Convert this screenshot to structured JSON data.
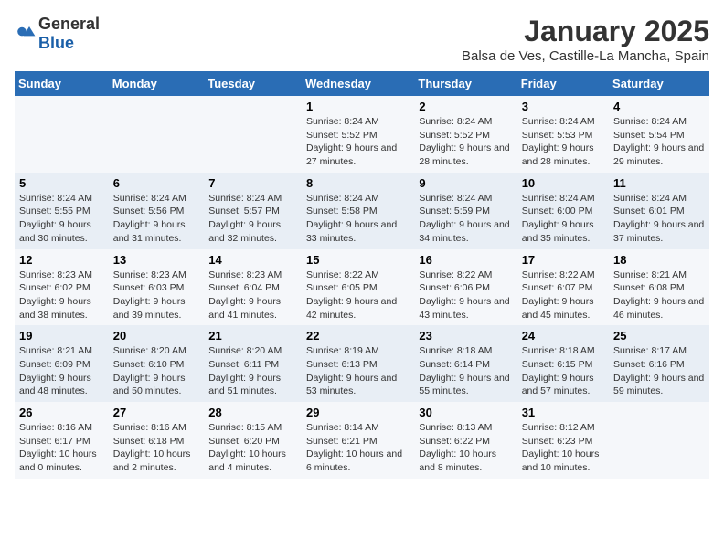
{
  "logo": {
    "general": "General",
    "blue": "Blue"
  },
  "title": "January 2025",
  "subtitle": "Balsa de Ves, Castille-La Mancha, Spain",
  "weekdays": [
    "Sunday",
    "Monday",
    "Tuesday",
    "Wednesday",
    "Thursday",
    "Friday",
    "Saturday"
  ],
  "weeks": [
    [
      {
        "day": "",
        "content": ""
      },
      {
        "day": "",
        "content": ""
      },
      {
        "day": "",
        "content": ""
      },
      {
        "day": "1",
        "content": "Sunrise: 8:24 AM\nSunset: 5:52 PM\nDaylight: 9 hours and 27 minutes."
      },
      {
        "day": "2",
        "content": "Sunrise: 8:24 AM\nSunset: 5:52 PM\nDaylight: 9 hours and 28 minutes."
      },
      {
        "day": "3",
        "content": "Sunrise: 8:24 AM\nSunset: 5:53 PM\nDaylight: 9 hours and 28 minutes."
      },
      {
        "day": "4",
        "content": "Sunrise: 8:24 AM\nSunset: 5:54 PM\nDaylight: 9 hours and 29 minutes."
      }
    ],
    [
      {
        "day": "5",
        "content": "Sunrise: 8:24 AM\nSunset: 5:55 PM\nDaylight: 9 hours and 30 minutes."
      },
      {
        "day": "6",
        "content": "Sunrise: 8:24 AM\nSunset: 5:56 PM\nDaylight: 9 hours and 31 minutes."
      },
      {
        "day": "7",
        "content": "Sunrise: 8:24 AM\nSunset: 5:57 PM\nDaylight: 9 hours and 32 minutes."
      },
      {
        "day": "8",
        "content": "Sunrise: 8:24 AM\nSunset: 5:58 PM\nDaylight: 9 hours and 33 minutes."
      },
      {
        "day": "9",
        "content": "Sunrise: 8:24 AM\nSunset: 5:59 PM\nDaylight: 9 hours and 34 minutes."
      },
      {
        "day": "10",
        "content": "Sunrise: 8:24 AM\nSunset: 6:00 PM\nDaylight: 9 hours and 35 minutes."
      },
      {
        "day": "11",
        "content": "Sunrise: 8:24 AM\nSunset: 6:01 PM\nDaylight: 9 hours and 37 minutes."
      }
    ],
    [
      {
        "day": "12",
        "content": "Sunrise: 8:23 AM\nSunset: 6:02 PM\nDaylight: 9 hours and 38 minutes."
      },
      {
        "day": "13",
        "content": "Sunrise: 8:23 AM\nSunset: 6:03 PM\nDaylight: 9 hours and 39 minutes."
      },
      {
        "day": "14",
        "content": "Sunrise: 8:23 AM\nSunset: 6:04 PM\nDaylight: 9 hours and 41 minutes."
      },
      {
        "day": "15",
        "content": "Sunrise: 8:22 AM\nSunset: 6:05 PM\nDaylight: 9 hours and 42 minutes."
      },
      {
        "day": "16",
        "content": "Sunrise: 8:22 AM\nSunset: 6:06 PM\nDaylight: 9 hours and 43 minutes."
      },
      {
        "day": "17",
        "content": "Sunrise: 8:22 AM\nSunset: 6:07 PM\nDaylight: 9 hours and 45 minutes."
      },
      {
        "day": "18",
        "content": "Sunrise: 8:21 AM\nSunset: 6:08 PM\nDaylight: 9 hours and 46 minutes."
      }
    ],
    [
      {
        "day": "19",
        "content": "Sunrise: 8:21 AM\nSunset: 6:09 PM\nDaylight: 9 hours and 48 minutes."
      },
      {
        "day": "20",
        "content": "Sunrise: 8:20 AM\nSunset: 6:10 PM\nDaylight: 9 hours and 50 minutes."
      },
      {
        "day": "21",
        "content": "Sunrise: 8:20 AM\nSunset: 6:11 PM\nDaylight: 9 hours and 51 minutes."
      },
      {
        "day": "22",
        "content": "Sunrise: 8:19 AM\nSunset: 6:13 PM\nDaylight: 9 hours and 53 minutes."
      },
      {
        "day": "23",
        "content": "Sunrise: 8:18 AM\nSunset: 6:14 PM\nDaylight: 9 hours and 55 minutes."
      },
      {
        "day": "24",
        "content": "Sunrise: 8:18 AM\nSunset: 6:15 PM\nDaylight: 9 hours and 57 minutes."
      },
      {
        "day": "25",
        "content": "Sunrise: 8:17 AM\nSunset: 6:16 PM\nDaylight: 9 hours and 59 minutes."
      }
    ],
    [
      {
        "day": "26",
        "content": "Sunrise: 8:16 AM\nSunset: 6:17 PM\nDaylight: 10 hours and 0 minutes."
      },
      {
        "day": "27",
        "content": "Sunrise: 8:16 AM\nSunset: 6:18 PM\nDaylight: 10 hours and 2 minutes."
      },
      {
        "day": "28",
        "content": "Sunrise: 8:15 AM\nSunset: 6:20 PM\nDaylight: 10 hours and 4 minutes."
      },
      {
        "day": "29",
        "content": "Sunrise: 8:14 AM\nSunset: 6:21 PM\nDaylight: 10 hours and 6 minutes."
      },
      {
        "day": "30",
        "content": "Sunrise: 8:13 AM\nSunset: 6:22 PM\nDaylight: 10 hours and 8 minutes."
      },
      {
        "day": "31",
        "content": "Sunrise: 8:12 AM\nSunset: 6:23 PM\nDaylight: 10 hours and 10 minutes."
      },
      {
        "day": "",
        "content": ""
      }
    ]
  ]
}
